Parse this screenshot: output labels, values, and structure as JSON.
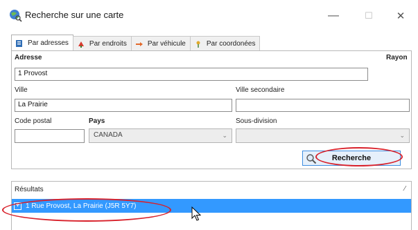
{
  "window": {
    "title": "Recherche sur une carte",
    "app_icon": "globe-search-icon",
    "controls": {
      "minimize": "—",
      "maximize": "☐",
      "close": "✕"
    }
  },
  "tabs": [
    {
      "label": "Par adresses",
      "icon": "address-book-icon",
      "active": true
    },
    {
      "label": "Par endroits",
      "icon": "location-arrows-icon",
      "active": false
    },
    {
      "label": "Par véhicule",
      "icon": "vehicle-arrow-icon",
      "active": false
    },
    {
      "label": "Par coordonées",
      "icon": "coordinate-pin-icon",
      "active": false
    }
  ],
  "form": {
    "address_label": "Adresse",
    "address_value": "1 Provost",
    "radius_label": "Rayon",
    "city_label": "Ville",
    "city_value": "La Prairie",
    "secondary_city_label": "Ville secondaire",
    "secondary_city_value": "",
    "postal_code_label": "Code postal",
    "postal_code_value": "",
    "country_label": "Pays",
    "country_value": "CANADA",
    "subdivision_label": "Sous-division",
    "subdivision_value": "",
    "search_button": "Recherche"
  },
  "results": {
    "header": "Résultats",
    "pin_glyph": "⁄",
    "items": [
      {
        "label": "1 Rue Provost, La Prairie (J5R 5Y7)",
        "selected": true,
        "expander": "+"
      }
    ]
  },
  "colors": {
    "selection": "#3399ff",
    "annotation": "#d8202a",
    "button_border": "#3c8de0"
  }
}
